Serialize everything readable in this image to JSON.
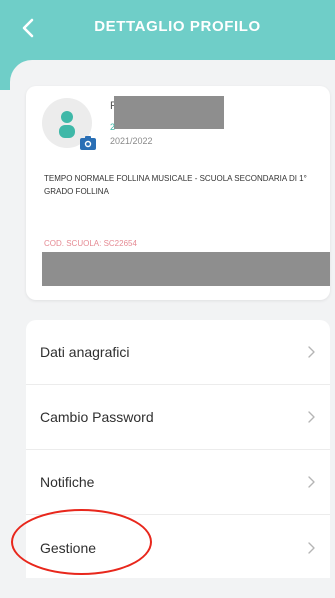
{
  "header": {
    "title": "DETTAGLIO PROFILO",
    "bg_color": "#6fcec8"
  },
  "profile": {
    "name_initial": "F",
    "green_mark": "2",
    "school_year": "2021/2022",
    "school_name": "TEMPO NORMALE FOLLINA MUSICALE - SCUOLA SECONDARIA DI 1° GRADO FOLLINA",
    "school_code": "COD. SCUOLA: SC22654",
    "avatar_icon": "user-avatar-icon",
    "camera_icon": "camera-icon"
  },
  "menu": {
    "items": [
      {
        "label": "Dati anagrafici"
      },
      {
        "label": "Cambio Password"
      },
      {
        "label": "Notifiche"
      },
      {
        "label": "Gestione"
      }
    ]
  },
  "colors": {
    "accent": "#6fcec8",
    "code_color": "#e58a93",
    "highlight": "#e8271c"
  }
}
